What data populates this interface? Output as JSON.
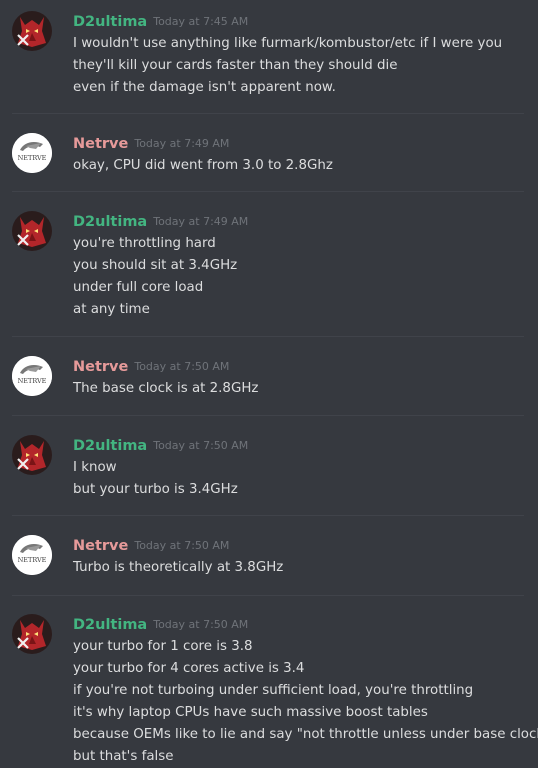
{
  "messages": [
    {
      "author": "D2ultima",
      "timestamp": "Today at 7:45 AM",
      "lines": [
        "I wouldn't use anything like furmark/kombustor/etc if I were you",
        "they'll kill your cards faster than they should die",
        "even if the damage isn't apparent now."
      ]
    },
    {
      "author": "Netrve",
      "timestamp": "Today at 7:49 AM",
      "lines": [
        "okay, CPU did went from 3.0 to 2.8Ghz"
      ]
    },
    {
      "author": "D2ultima",
      "timestamp": "Today at 7:49 AM",
      "lines": [
        "you're throttling hard",
        "you should sit at 3.4GHz",
        "under full core load",
        "at any time"
      ]
    },
    {
      "author": "Netrve",
      "timestamp": "Today at 7:50 AM",
      "lines": [
        "The base clock is at 2.8GHz"
      ]
    },
    {
      "author": "D2ultima",
      "timestamp": "Today at 7:50 AM",
      "lines": [
        "I know",
        "but your turbo is 3.4GHz"
      ]
    },
    {
      "author": "Netrve",
      "timestamp": "Today at 7:50 AM",
      "lines": [
        "Turbo is theoretically at 3.8GHz"
      ]
    },
    {
      "author": "D2ultima",
      "timestamp": "Today at 7:50 AM",
      "lines": [
        "your turbo for 1 core is 3.8",
        "your turbo for 4 cores active is 3.4",
        "if you're not turboing under sufficient load, you're throttling",
        "it's why laptop CPUs have such massive boost tables",
        "because OEMs like to lie and say \"not throttle unless under base clock\"",
        "but that's false"
      ]
    }
  ],
  "avatars": {
    "netrve_badge": "NETRVE"
  },
  "colors": {
    "background": "#36393f",
    "d2ultima_name": "#43b581",
    "netrve_name": "#e69a9a",
    "timestamp": "#6f7379",
    "text": "#dcddde",
    "divider": "#40434a"
  }
}
